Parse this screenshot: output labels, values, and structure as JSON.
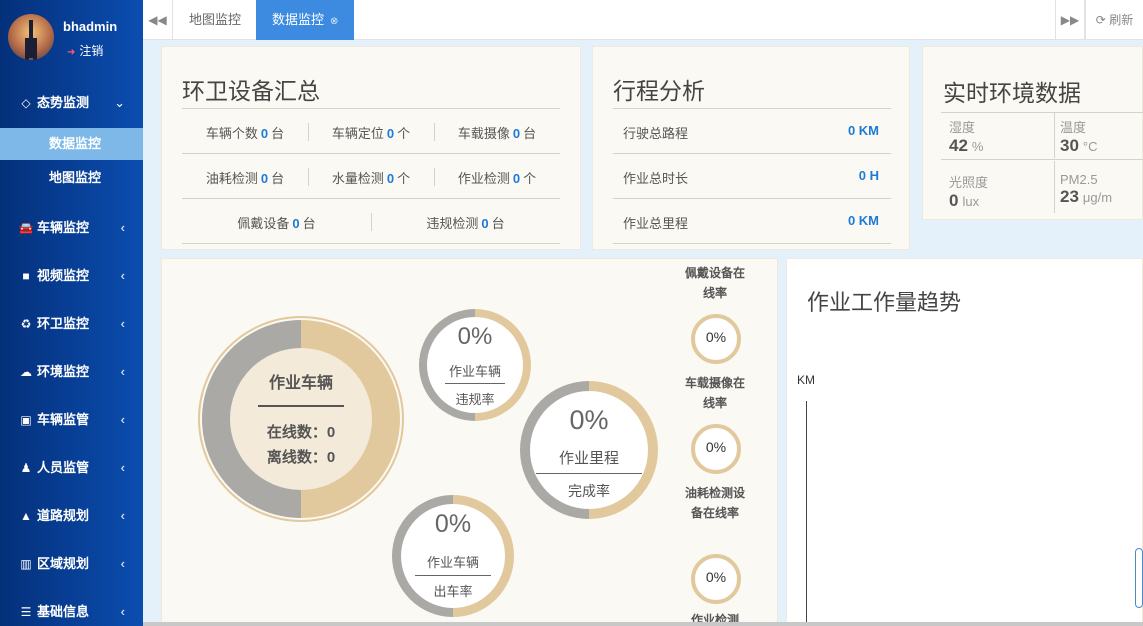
{
  "user": {
    "name": "bhadmin",
    "logout": "注销"
  },
  "sidebar": {
    "group": {
      "label": "态势监测",
      "icon": "diamond-icon"
    },
    "sub": [
      "数据监控",
      "地图监控"
    ],
    "items": [
      {
        "label": "车辆监控",
        "icon": "car-icon"
      },
      {
        "label": "视频监控",
        "icon": "video-icon"
      },
      {
        "label": "环卫监控",
        "icon": "recycle-icon"
      },
      {
        "label": "环境监控",
        "icon": "cloud-icon"
      },
      {
        "label": "车辆监管",
        "icon": "bus-icon"
      },
      {
        "label": "人员监管",
        "icon": "person-icon"
      },
      {
        "label": "道路规划",
        "icon": "road-icon"
      },
      {
        "label": "区域规划",
        "icon": "map-icon"
      },
      {
        "label": "基础信息",
        "icon": "list-icon"
      }
    ]
  },
  "tabs": {
    "items": [
      "地图监控",
      "数据监控"
    ],
    "refresh": "刷新"
  },
  "equip": {
    "title": "环卫设备汇总",
    "rows": [
      [
        {
          "label": "车辆个数",
          "value": "0",
          "unit": "台"
        },
        {
          "label": "车辆定位",
          "value": "0",
          "unit": "个"
        },
        {
          "label": "车载摄像",
          "value": "0",
          "unit": "台"
        }
      ],
      [
        {
          "label": "油耗检测",
          "value": "0",
          "unit": "台"
        },
        {
          "label": "水量检测",
          "value": "0",
          "unit": "个"
        },
        {
          "label": "作业检测",
          "value": "0",
          "unit": "个"
        }
      ],
      [
        {
          "label": "佩戴设备",
          "value": "0",
          "unit": "台"
        },
        {
          "label": "违规检测",
          "value": "0",
          "unit": "台"
        }
      ]
    ]
  },
  "trip": {
    "title": "行程分析",
    "rows": [
      {
        "label": "行驶总路程",
        "value": "0  KM"
      },
      {
        "label": "作业总时长",
        "value": "0  H"
      },
      {
        "label": "作业总里程",
        "value": "0  KM"
      }
    ]
  },
  "env": {
    "title": "实时环境数据",
    "items": [
      {
        "label": "湿度",
        "value": "42",
        "unit": "%"
      },
      {
        "label": "温度",
        "value": "30",
        "unit": "°C"
      },
      {
        "label": "光照度",
        "value": "0",
        "unit": "lux"
      },
      {
        "label": "PM2.5",
        "value": "23",
        "unit": "μg/m"
      }
    ]
  },
  "vehicle": {
    "title": "作业车辆",
    "online": "在线数：0",
    "offline": "离线数：0"
  },
  "rates": [
    {
      "pct": "0%",
      "top": "作业车辆",
      "bottom": "违规率"
    },
    {
      "pct": "0%",
      "top": "作业里程",
      "bottom": "完成率"
    },
    {
      "pct": "0%",
      "top": "作业车辆",
      "bottom": "出车率"
    }
  ],
  "online": [
    {
      "label": "佩戴设备在线率",
      "pct": "0%"
    },
    {
      "label": "车载摄像在线率",
      "pct": "0%"
    },
    {
      "label": "油耗检测设备在线率",
      "pct": "0%"
    },
    {
      "label": "作业检测"
    }
  ],
  "trend": {
    "title": "作业工作量趋势",
    "unit": "KM"
  }
}
